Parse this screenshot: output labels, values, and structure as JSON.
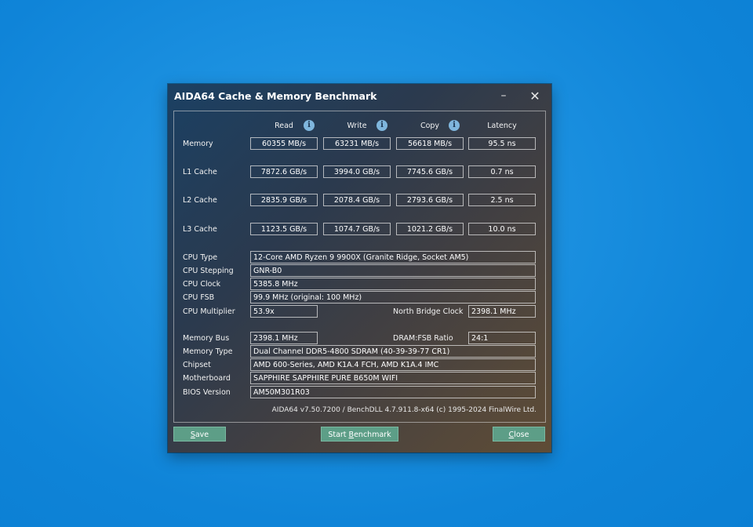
{
  "window": {
    "title": "AIDA64 Cache & Memory Benchmark",
    "minimize_glyph": "–",
    "close_glyph": "✕"
  },
  "columns": {
    "read": "Read",
    "write": "Write",
    "copy": "Copy",
    "latency": "Latency",
    "info_glyph": "i"
  },
  "benchmark": [
    {
      "label": "Memory",
      "read": "60355 MB/s",
      "write": "63231 MB/s",
      "copy": "56618 MB/s",
      "latency": "95.5 ns"
    },
    {
      "label": "L1 Cache",
      "read": "7872.6 GB/s",
      "write": "3994.0 GB/s",
      "copy": "7745.6 GB/s",
      "latency": "0.7 ns"
    },
    {
      "label": "L2 Cache",
      "read": "2835.9 GB/s",
      "write": "2078.4 GB/s",
      "copy": "2793.6 GB/s",
      "latency": "2.5 ns"
    },
    {
      "label": "L3 Cache",
      "read": "1123.5 GB/s",
      "write": "1074.7 GB/s",
      "copy": "1021.2 GB/s",
      "latency": "10.0 ns"
    }
  ],
  "cpu": {
    "type_label": "CPU Type",
    "type_value": "12-Core AMD Ryzen 9 9900X  (Granite Ridge, Socket AM5)",
    "stepping_label": "CPU Stepping",
    "stepping_value": "GNR-B0",
    "clock_label": "CPU Clock",
    "clock_value": "5385.8 MHz",
    "fsb_label": "CPU FSB",
    "fsb_value": "99.9 MHz  (original: 100 MHz)",
    "multiplier_label": "CPU Multiplier",
    "multiplier_value": "53.9x",
    "nb_clock_label": "North Bridge Clock",
    "nb_clock_value": "2398.1 MHz"
  },
  "memory": {
    "bus_label": "Memory Bus",
    "bus_value": "2398.1 MHz",
    "ratio_label": "DRAM:FSB Ratio",
    "ratio_value": "24:1",
    "type_label": "Memory Type",
    "type_value": "Dual Channel DDR5-4800 SDRAM  (40-39-39-77 CR1)",
    "chipset_label": "Chipset",
    "chipset_value": "AMD 600-Series, AMD K1A.4 FCH, AMD K1A.4 IMC",
    "motherboard_label": "Motherboard",
    "motherboard_value": "SAPPHIRE SAPPHIRE PURE B650M WIFI",
    "bios_label": "BIOS Version",
    "bios_value": "AM50M301R03"
  },
  "footer": "AIDA64 v7.50.7200 / BenchDLL 4.7.911.8-x64  (c) 1995-2024 FinalWire Ltd.",
  "buttons": {
    "save_first": "S",
    "save_rest": "ave",
    "start_pre": "Start ",
    "start_ul": "B",
    "start_rest": "enchmark",
    "close_first": "C",
    "close_rest": "lose"
  }
}
